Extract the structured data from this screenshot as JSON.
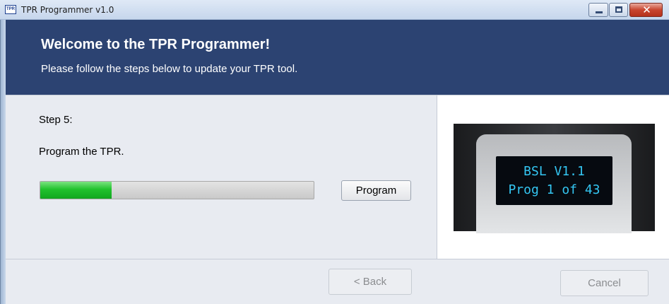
{
  "window": {
    "title": "TPR Programmer v1.0",
    "icon_text": "TPR",
    "controls": {
      "close_glyph": "✕"
    }
  },
  "header": {
    "title": "Welcome to the TPR Programmer!",
    "subtitle": "Please follow the steps below to update your TPR tool."
  },
  "step": {
    "label": "Step 5:",
    "description": "Program the TPR."
  },
  "progress": {
    "fraction": 0.26,
    "fill_color": "#21c22d"
  },
  "buttons": {
    "program": "Program",
    "back": "< Back",
    "cancel": "Cancel"
  },
  "device_display": {
    "line1": "BSL V1.1",
    "line2": "Prog 1 of 43"
  },
  "colors": {
    "banner": "#2c4372",
    "lcd_text": "#34c6f2"
  }
}
